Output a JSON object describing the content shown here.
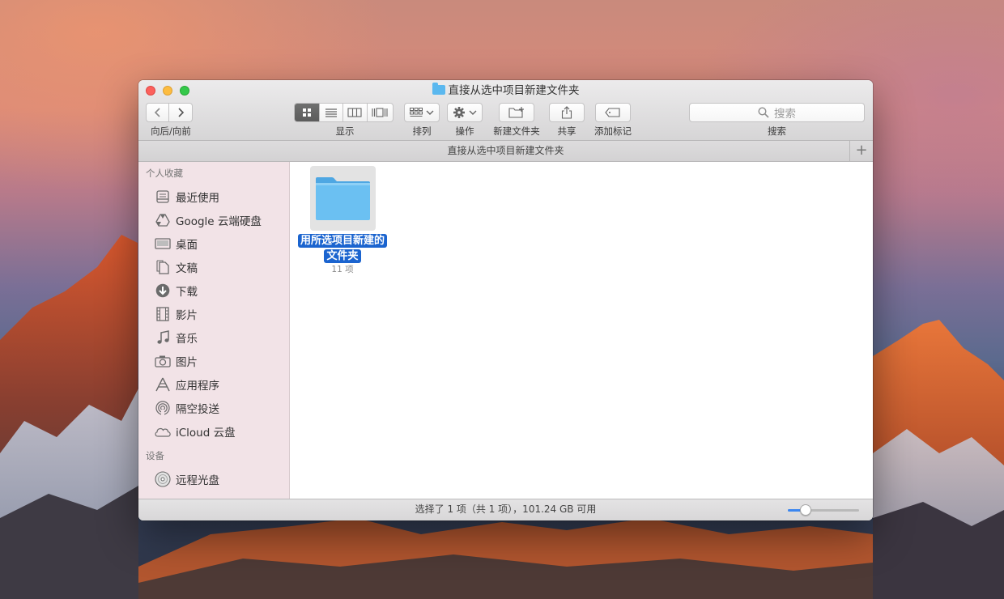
{
  "window": {
    "title": "直接从选中项目新建文件夹"
  },
  "toolbar": {
    "nav_label": "向后/向前",
    "view_label": "显示",
    "sort_label": "排列",
    "action_label": "操作",
    "new_folder_label": "新建文件夹",
    "share_label": "共享",
    "tag_label": "添加标记",
    "search_label": "搜索",
    "search_placeholder": "搜索",
    "active_view": "icon"
  },
  "pathbar": {
    "title": "直接从选中项目新建文件夹",
    "add_tab": "+"
  },
  "sidebar": {
    "favorites_header": "个人收藏",
    "favorites": [
      {
        "label": "最近使用",
        "icon": "recents-icon"
      },
      {
        "label": "Google 云端硬盘",
        "icon": "google-drive-icon"
      },
      {
        "label": "桌面",
        "icon": "desktop-icon"
      },
      {
        "label": "文稿",
        "icon": "documents-icon"
      },
      {
        "label": "下载",
        "icon": "downloads-icon"
      },
      {
        "label": "影片",
        "icon": "movies-icon"
      },
      {
        "label": "音乐",
        "icon": "music-icon"
      },
      {
        "label": "图片",
        "icon": "pictures-icon"
      },
      {
        "label": "应用程序",
        "icon": "applications-icon"
      },
      {
        "label": "隔空投送",
        "icon": "airdrop-icon"
      },
      {
        "label": "iCloud 云盘",
        "icon": "icloud-icon"
      }
    ],
    "devices_header": "设备",
    "devices": [
      {
        "label": "远程光盘",
        "icon": "remote-disc-icon"
      }
    ]
  },
  "content": {
    "items": [
      {
        "name": "用所选项目新建的文件夹",
        "count": "11 项",
        "selected": true
      }
    ]
  },
  "statusbar": {
    "text": "选择了 1 项（共 1 项），101.24 GB 可用",
    "icon_size_level": 0.25
  },
  "colors": {
    "selection": "#1b64cf",
    "folder": "#5bb8ef",
    "close": "#fc605c",
    "minimize": "#fdbc40",
    "maximize": "#34c84a"
  }
}
